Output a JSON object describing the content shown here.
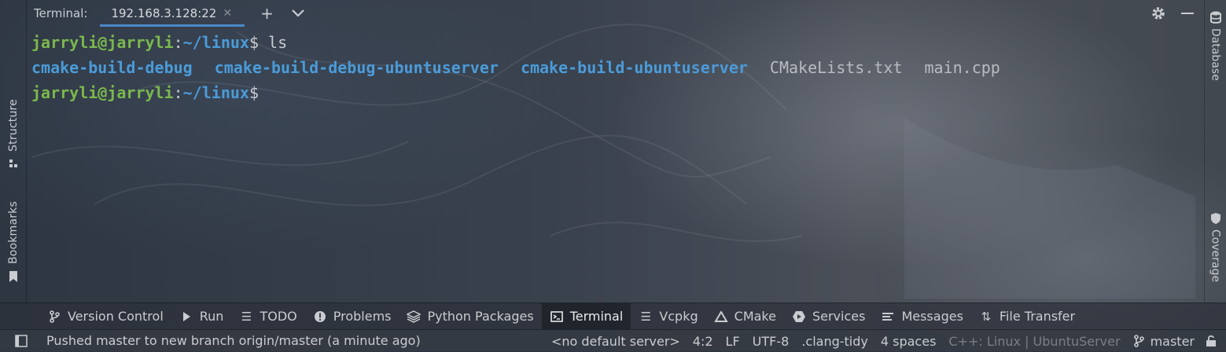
{
  "terminal": {
    "label": "Terminal:",
    "tab": "192.168.3.128:22",
    "lines": [
      {
        "user": "jarryli@jarryli",
        "sep": ":",
        "path": "~/linux",
        "prompt": "$",
        "cmd": " ls"
      },
      {
        "user": "jarryli@jarryli",
        "sep": ":",
        "path": "~/linux",
        "prompt": "$",
        "cmd": ""
      }
    ],
    "ls_output": {
      "dirs": [
        "cmake-build-debug",
        "cmake-build-debug-ubuntuserver",
        "cmake-build-ubuntuserver"
      ],
      "files": [
        "CMakeLists.txt",
        "main.cpp"
      ]
    }
  },
  "left_tools": {
    "structure": "Structure",
    "bookmarks": "Bookmarks"
  },
  "right_tools": {
    "database": "Database",
    "coverage": "Coverage"
  },
  "tool_windows": [
    {
      "label": "Version Control",
      "icon": "branch-icon"
    },
    {
      "label": "Run",
      "icon": "play-icon"
    },
    {
      "label": "TODO",
      "icon": "list-icon"
    },
    {
      "label": "Problems",
      "icon": "warning-circle-icon"
    },
    {
      "label": "Python Packages",
      "icon": "layers-icon"
    },
    {
      "label": "Terminal",
      "icon": "terminal-icon",
      "active": true
    },
    {
      "label": "Vcpkg",
      "icon": "list-icon"
    },
    {
      "label": "CMake",
      "icon": "triangle-icon"
    },
    {
      "label": "Services",
      "icon": "services-icon"
    },
    {
      "label": "Messages",
      "icon": "messages-icon"
    },
    {
      "label": "File Transfer",
      "icon": "transfer-icon"
    }
  ],
  "status": {
    "message": "Pushed master to new branch origin/master (a minute ago)",
    "server": "<no default server>",
    "position": "4:2",
    "line_sep": "LF",
    "encoding": "UTF-8",
    "linter": ".clang-tidy",
    "indent": "4 spaces",
    "context": "C++: Linux | UbuntuServer",
    "branch": "master"
  }
}
